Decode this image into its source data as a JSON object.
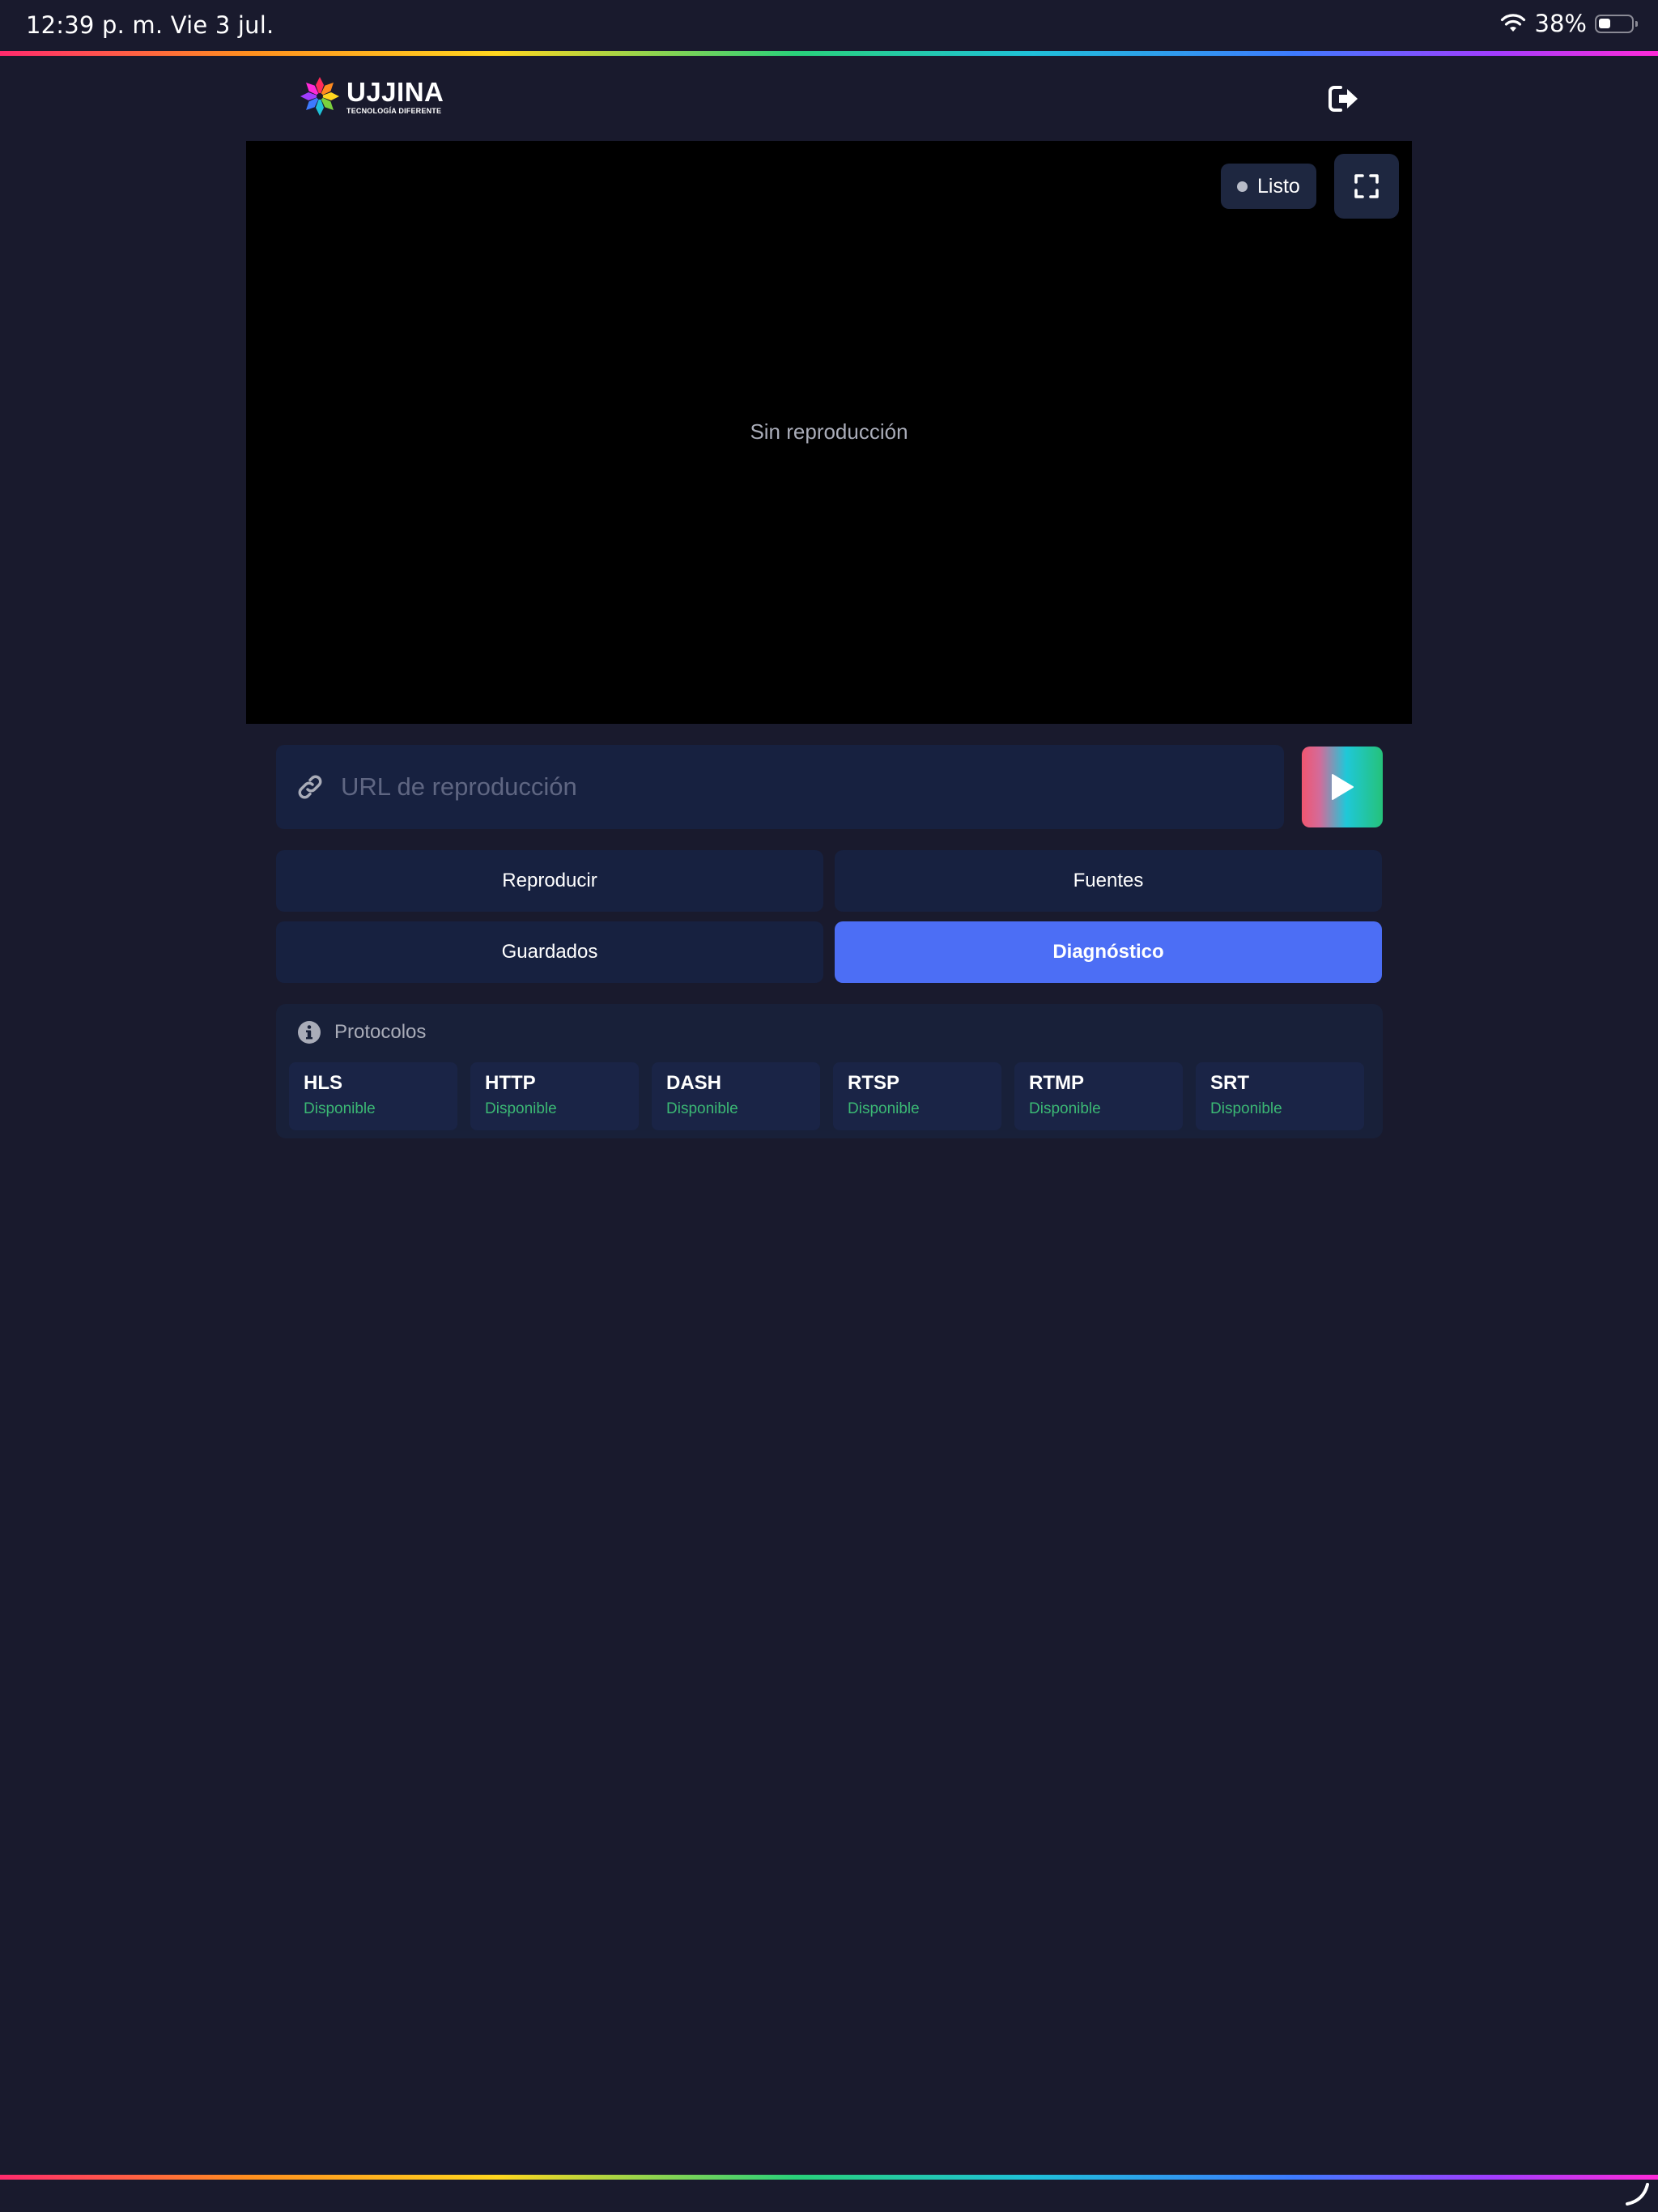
{
  "status_bar": {
    "time": "12:39 p. m.   Vie 3 jul.",
    "battery_percent": "38%",
    "battery_level": 0.38
  },
  "header": {
    "logo_name": "UJJINA",
    "logo_tagline": "TECNOLOGÍA DIFERENTE",
    "logout_icon": "logout-icon"
  },
  "player": {
    "status_label": "Listo",
    "empty_message": "Sin reproducción",
    "fullscreen_icon": "fullscreen-icon"
  },
  "url_bar": {
    "placeholder": "URL de reproducción",
    "value": "",
    "play_icon": "play-icon"
  },
  "tabs": [
    {
      "label": "Reproducir",
      "active": false
    },
    {
      "label": "Fuentes",
      "active": false
    },
    {
      "label": "Guardados",
      "active": false
    },
    {
      "label": "Diagnóstico",
      "active": true
    }
  ],
  "protocols": {
    "title": "Protocolos",
    "items": [
      {
        "name": "HLS",
        "status": "Disponible"
      },
      {
        "name": "HTTP",
        "status": "Disponible"
      },
      {
        "name": "DASH",
        "status": "Disponible"
      },
      {
        "name": "RTSP",
        "status": "Disponible"
      },
      {
        "name": "RTMP",
        "status": "Disponible"
      },
      {
        "name": "SRT",
        "status": "Disponible"
      }
    ]
  },
  "colors": {
    "background": "#191a2d",
    "surface": "#172140",
    "accent": "#4c6ef5",
    "available": "#3bb874"
  }
}
